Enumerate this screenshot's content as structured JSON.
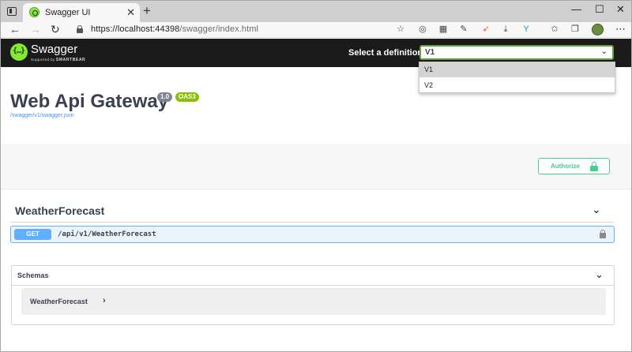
{
  "browser": {
    "tab_title": "Swagger UI",
    "tab_close": "✕",
    "new_tab": "+",
    "window_controls": [
      "—",
      "☐",
      "✕"
    ],
    "nav": {
      "back": "←",
      "forward": "→",
      "refresh": "↻"
    },
    "url_host": "https://localhost:44398",
    "url_path": "/swagger/index.html",
    "extensions": [
      "star-add-icon",
      "extension-icon",
      "qr-icon",
      "pen-icon",
      "swift-icon",
      "download-icon",
      "fork-icon",
      "favorites-icon",
      "collections-icon"
    ],
    "more": "⋯"
  },
  "topbar": {
    "brand": "Swagger",
    "brand_sub_prefix": "Supported by ",
    "brand_sub_company": "SMARTBEAR",
    "select_label": "Select a definition",
    "selected": "V1"
  },
  "dropdown": {
    "options": [
      "V1",
      "V2"
    ]
  },
  "info": {
    "title": "Web Api Gateway",
    "version": "1.0",
    "oas": "OAS3",
    "spec_url": "/swagger/v1/swagger.json"
  },
  "auth": {
    "label": "Authorize"
  },
  "tag": {
    "name": "WeatherForecast",
    "operations": [
      {
        "method": "GET",
        "path": "/api/v1/WeatherForecast"
      }
    ]
  },
  "schemas": {
    "title": "Schemas",
    "models": [
      "WeatherForecast"
    ]
  },
  "colors": {
    "topbar_bg": "#1b1b1b",
    "accent_green": "#62a03f",
    "get_blue": "#61affe",
    "authorize_green": "#49cc90",
    "oas_badge": "#89bf04",
    "version_badge": "#7d8492"
  }
}
